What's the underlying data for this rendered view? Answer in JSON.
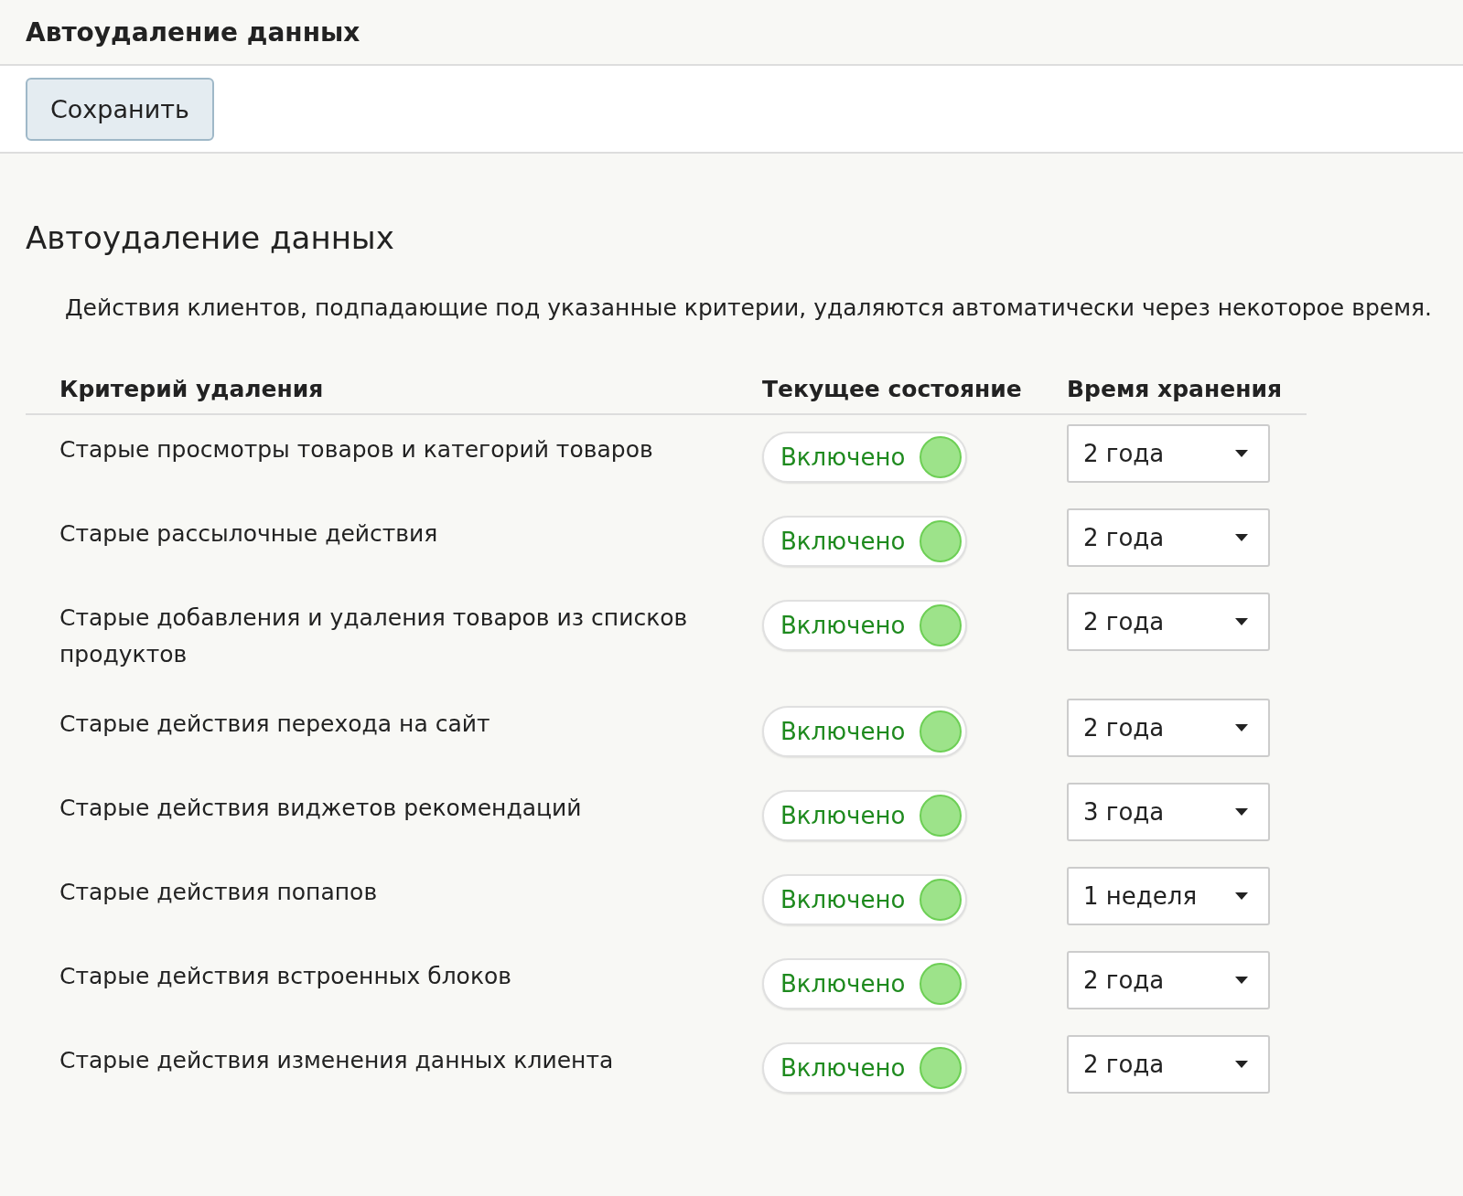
{
  "topbar": {
    "title": "Автоудаление данных"
  },
  "toolbar": {
    "save_button": "Сохранить"
  },
  "section": {
    "heading": "Автоудаление данных",
    "description": "Действия клиентов, подпадающие под указанные критерии, удаляются автоматически через некоторое время."
  },
  "table": {
    "columns": [
      "Критерий удаления",
      "Текущее состояние",
      "Время хранения"
    ],
    "rows": [
      {
        "criterion": "Старые просмотры товаров и категорий товаров",
        "state": "Включено",
        "on": true,
        "retention": "2 года"
      },
      {
        "criterion": "Старые рассылочные действия",
        "state": "Включено",
        "on": true,
        "retention": "2 года"
      },
      {
        "criterion": "Старые добавления и удаления товаров из списков продуктов",
        "state": "Включено",
        "on": true,
        "retention": "2 года"
      },
      {
        "criterion": "Старые действия перехода на сайт",
        "state": "Включено",
        "on": true,
        "retention": "2 года"
      },
      {
        "criterion": "Старые действия виджетов рекомендаций",
        "state": "Включено",
        "on": true,
        "retention": "3 года"
      },
      {
        "criterion": "Старые действия попапов",
        "state": "Включено",
        "on": true,
        "retention": "1 неделя"
      },
      {
        "criterion": "Старые действия встроенных блоков",
        "state": "Включено",
        "on": true,
        "retention": "2 года"
      },
      {
        "criterion": "Старые действия изменения данных клиента",
        "state": "Включено",
        "on": true,
        "retention": "2 года"
      }
    ]
  }
}
